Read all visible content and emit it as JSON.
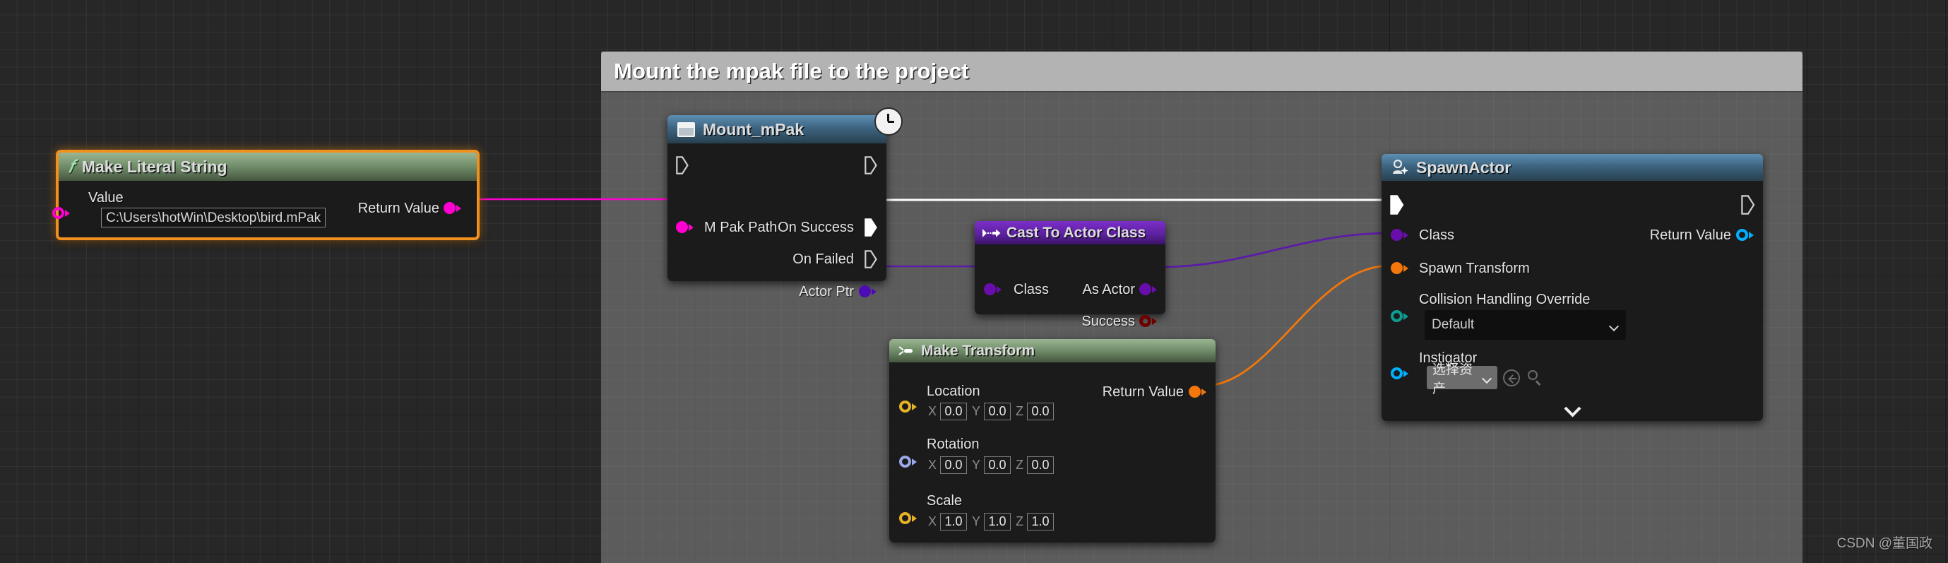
{
  "canvas": {
    "background_color": "#272727",
    "grid_color": "#333333"
  },
  "comment": {
    "title": "Mount the mpak file to the project",
    "color": "#b3b3b3"
  },
  "nodes": {
    "make_literal_string": {
      "title": "Make Literal String",
      "icon": "function-icon",
      "header_color": "#6f8c69",
      "selected": true,
      "selection_color": "#f0901e",
      "inputs": [
        {
          "label": "Value",
          "pin_color": "#ff00d0",
          "value": "C:\\Users\\hotWin\\Desktop\\bird.mPak"
        }
      ],
      "outputs": [
        {
          "label": "Return Value",
          "pin_color": "#ff00d0"
        }
      ]
    },
    "mount_mpak": {
      "title": "Mount_mPak",
      "icon": "node-icon",
      "header_color": "#3d6480",
      "badge": "clock-icon",
      "exec_in": "",
      "exec_out": "",
      "inputs": [
        {
          "label": "M Pak Path",
          "pin_color": "#ff00d0"
        }
      ],
      "outputs": [
        {
          "label": "On Success",
          "pin_color": "#ffffff",
          "type": "exec"
        },
        {
          "label": "On Failed",
          "pin_color": "#ffffff",
          "type": "exec"
        },
        {
          "label": "Actor Ptr",
          "pin_color": "#4b0bb5",
          "type": "object"
        }
      ]
    },
    "cast_to_actor_class": {
      "title": "Cast To Actor Class",
      "icon": "cast-icon",
      "header_color": "#5d22a0",
      "inputs": [
        {
          "label": "Class",
          "pin_color": "#6a0dad"
        }
      ],
      "outputs": [
        {
          "label": "As Actor",
          "pin_color": "#6a0dad"
        },
        {
          "label": "Success",
          "pin_color": "#6b0000"
        }
      ]
    },
    "make_transform": {
      "title": "Make Transform",
      "icon": "make-struct-icon",
      "header_color": "#6f8c69",
      "inputs": [
        {
          "label": "Location",
          "pin_color": "#e6b325",
          "axes": [
            "X",
            "Y",
            "Z"
          ],
          "values": [
            "0.0",
            "0.0",
            "0.0"
          ]
        },
        {
          "label": "Rotation",
          "pin_color": "#9aa8e8",
          "axes": [
            "X",
            "Y",
            "Z"
          ],
          "values": [
            "0.0",
            "0.0",
            "0.0"
          ]
        },
        {
          "label": "Scale",
          "pin_color": "#e6b325",
          "axes": [
            "X",
            "Y",
            "Z"
          ],
          "values": [
            "1.0",
            "1.0",
            "1.0"
          ]
        }
      ],
      "outputs": [
        {
          "label": "Return Value",
          "pin_color": "#f3770a"
        }
      ]
    },
    "spawn_actor": {
      "title": "SpawnActor",
      "icon": "spawn-actor-icon",
      "header_color": "#3d6480",
      "inputs": [
        {
          "label": "Class",
          "pin_color": "#6a0dad"
        },
        {
          "label": "Spawn Transform",
          "pin_color": "#f3770a"
        },
        {
          "label": "Collision Handling Override",
          "pin_color": "#0c9e93",
          "value": "Default"
        },
        {
          "label": "Instigator",
          "pin_color": "#00b0ff",
          "value": "选择资产"
        }
      ],
      "outputs": [
        {
          "label": "Return Value",
          "pin_color": "#00b0ff"
        }
      ],
      "expander": "chevron-down-icon"
    }
  },
  "watermark": {
    "text": "CSDN @董国政"
  }
}
